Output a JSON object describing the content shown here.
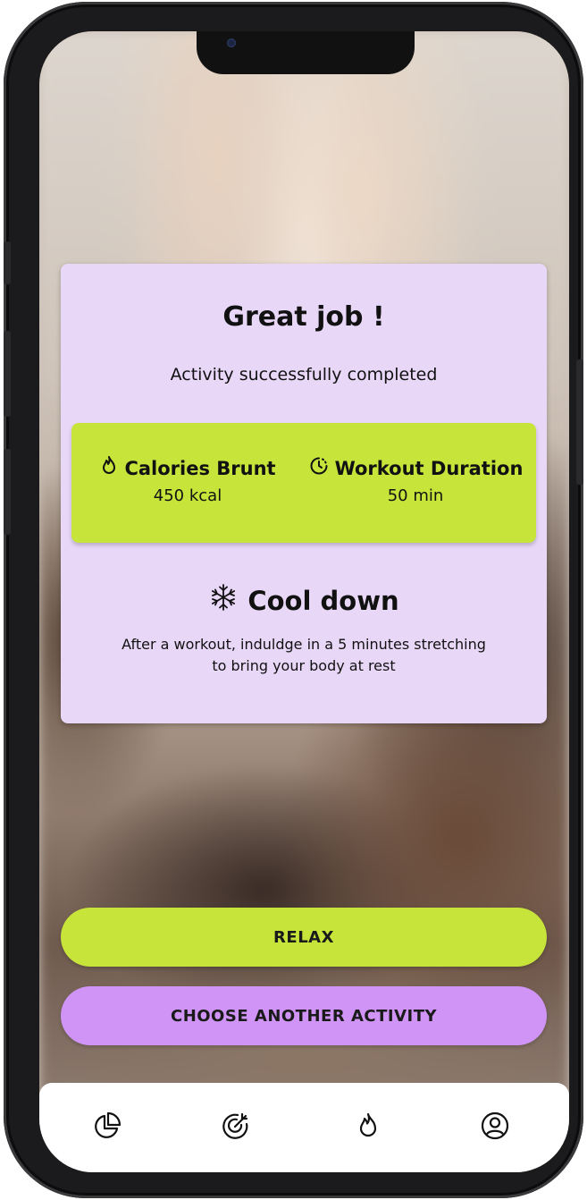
{
  "card": {
    "title": "Great job !",
    "subtitle": "Activity successfully completed",
    "stats": {
      "calories_label": "Calories Brunt",
      "calories_value": "450 kcal",
      "duration_label": "Workout Duration",
      "duration_value": "50 min"
    },
    "cooldown_title": "Cool down",
    "cooldown_text": "After a workout, induldge in a 5 minutes stretching to bring your body at rest"
  },
  "buttons": {
    "relax": "RELAX",
    "choose": "CHOOSE ANOTHER ACTIVITY"
  },
  "tabbar": {
    "icons": [
      "chart-pie-icon",
      "target-icon",
      "flame-icon",
      "user-icon"
    ]
  },
  "colors": {
    "card_bg": "#e9d7f8",
    "accent_green": "#c7e43a",
    "accent_purple": "#cf94f5"
  }
}
